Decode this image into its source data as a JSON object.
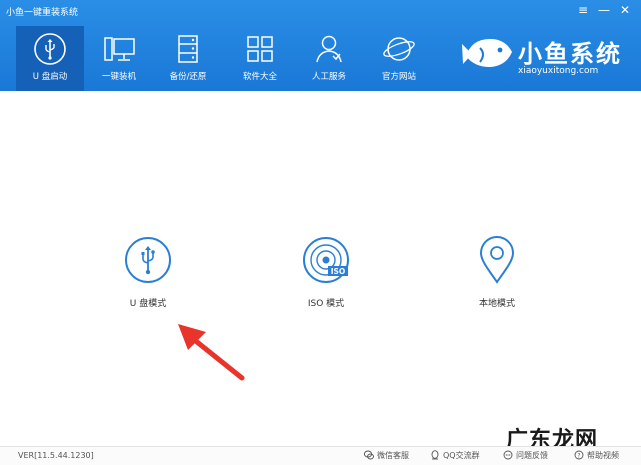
{
  "window": {
    "title": "小鱼一键重装系统",
    "menu_glyph": "≡",
    "minimize_glyph": "—",
    "close_glyph": "✕"
  },
  "nav": {
    "items": [
      {
        "label": "U 盘启动",
        "icon": "usb-icon",
        "active": true
      },
      {
        "label": "一键装机",
        "icon": "computer-icon"
      },
      {
        "label": "备份/还原",
        "icon": "backup-icon"
      },
      {
        "label": "软件大全",
        "icon": "apps-grid-icon"
      },
      {
        "label": "人工服务",
        "icon": "support-person-icon"
      },
      {
        "label": "官方网站",
        "icon": "planet-icon"
      }
    ]
  },
  "brand": {
    "name": "小鱼系统",
    "url": "xiaoyuxitong.com"
  },
  "modes": [
    {
      "label": "U 盘模式",
      "icon": "usb-circle-icon"
    },
    {
      "label": "ISO 模式",
      "icon": "iso-disc-icon",
      "badge": "ISO"
    },
    {
      "label": "本地模式",
      "icon": "location-pin-icon"
    }
  ],
  "status": {
    "version": "VER[11.5.44.1230]",
    "links": [
      {
        "label": "微信客服",
        "icon": "wechat-icon"
      },
      {
        "label": "QQ交流群",
        "icon": "qq-icon"
      },
      {
        "label": "问题反馈",
        "icon": "feedback-icon"
      },
      {
        "label": "帮助视频",
        "icon": "help-icon"
      }
    ]
  },
  "watermark": "广东龙网",
  "colors": {
    "header": "#1a78d6",
    "active_nav": "#1561b7",
    "accent": "#2a7fd4",
    "arrow": "#e8342a"
  }
}
